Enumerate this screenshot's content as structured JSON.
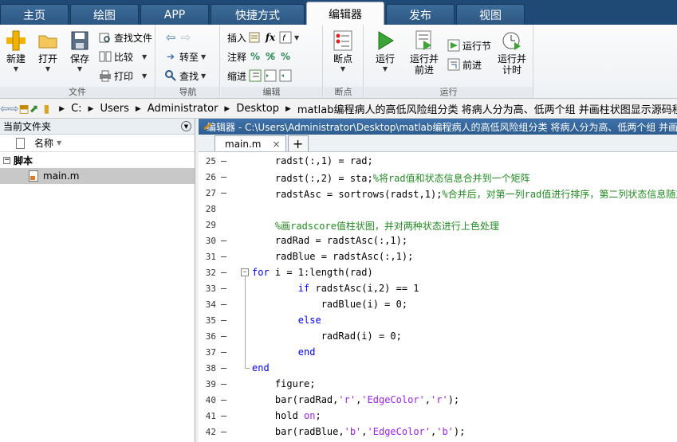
{
  "tabs": [
    "主页",
    "绘图",
    "APP",
    "快捷方式",
    "编辑器",
    "发布",
    "视图"
  ],
  "ribbon": {
    "file": {
      "new": "新建",
      "open": "打开",
      "save": "保存",
      "find_files": "查找文件",
      "compare": "比较",
      "print": "打印",
      "label": "文件"
    },
    "nav": {
      "goto": "转至",
      "find": "查找",
      "label": "导航"
    },
    "edit": {
      "insert": "插入",
      "comment": "注释",
      "indent": "缩进",
      "fx": "fx",
      "label": "编辑"
    },
    "breakpoints": {
      "bp": "断点",
      "label": "断点"
    },
    "run": {
      "run": "运行",
      "run_advance": "运行并\n前进",
      "run_section": "运行节",
      "advance": "前进",
      "run_time": "运行并\n计时",
      "label": "运行"
    }
  },
  "address": {
    "crumbs": [
      "C:",
      "Users",
      "Administrator",
      "Desktop",
      "matlab编程病人的高低风险组分类 将病人分为高、低两个组 并画柱状图显示源码程序"
    ]
  },
  "left_panel": {
    "title": "当前文件夹",
    "col_name": "名称",
    "group": "脚本",
    "file": "main.m"
  },
  "editor": {
    "title": "编辑器 - C:\\Users\\Administrator\\Desktop\\matlab编程病人的高低风险组分类 将病人分为高、低两个组 并画柱状图显示源码程序\\main.m",
    "tab": "main.m",
    "tab_close": "×",
    "add": "+"
  },
  "code_lines": [
    {
      "n": "25",
      "dash": "–",
      "parts": [
        [
          "    radst(:,1) = rad;",
          ""
        ]
      ]
    },
    {
      "n": "26",
      "dash": "–",
      "parts": [
        [
          "    radst(:,2) = sta;",
          ""
        ],
        [
          "%将rad值和状态信息合并到一个矩阵",
          "cm"
        ]
      ]
    },
    {
      "n": "27",
      "dash": "–",
      "parts": [
        [
          "    radstAsc = sortrows(radst,1);",
          ""
        ],
        [
          "%合并后，对第一列rad值进行排序，第二列状态信息随之变化",
          "cm"
        ]
      ]
    },
    {
      "n": "28",
      "dash": "",
      "parts": [
        [
          "",
          ""
        ]
      ]
    },
    {
      "n": "29",
      "dash": "",
      "parts": [
        [
          "    ",
          ""
        ],
        [
          "%画radscore值柱状图，并对两种状态进行上色处理",
          "cm"
        ]
      ]
    },
    {
      "n": "30",
      "dash": "–",
      "parts": [
        [
          "    radRad = radstAsc(:,1);",
          ""
        ]
      ]
    },
    {
      "n": "31",
      "dash": "–",
      "parts": [
        [
          "    radBlue = radstAsc(:,1);",
          ""
        ]
      ]
    },
    {
      "n": "32",
      "dash": "–",
      "fold": "−",
      "parts": [
        [
          "for",
          "kw"
        ],
        [
          " i = 1:length(rad)",
          ""
        ]
      ]
    },
    {
      "n": "33",
      "dash": "–",
      "parts": [
        [
          "        ",
          ""
        ],
        [
          "if",
          "kw"
        ],
        [
          " radstAsc(i,2) == 1",
          ""
        ]
      ]
    },
    {
      "n": "34",
      "dash": "–",
      "parts": [
        [
          "            radBlue(i) = 0;",
          ""
        ]
      ]
    },
    {
      "n": "35",
      "dash": "–",
      "parts": [
        [
          "        ",
          ""
        ],
        [
          "else",
          "kw"
        ]
      ]
    },
    {
      "n": "36",
      "dash": "–",
      "parts": [
        [
          "            radRad(i) = 0;",
          ""
        ]
      ]
    },
    {
      "n": "37",
      "dash": "–",
      "parts": [
        [
          "        ",
          ""
        ],
        [
          "end",
          "kw"
        ]
      ]
    },
    {
      "n": "38",
      "dash": "–",
      "parts": [
        [
          "end",
          "kw"
        ]
      ]
    },
    {
      "n": "39",
      "dash": "–",
      "parts": [
        [
          "    figure;",
          ""
        ]
      ]
    },
    {
      "n": "40",
      "dash": "–",
      "parts": [
        [
          "    bar(radRad,",
          ""
        ],
        [
          "'r'",
          "st"
        ],
        [
          ",",
          ""
        ],
        [
          "'EdgeColor'",
          "st"
        ],
        [
          ",",
          ""
        ],
        [
          "'r'",
          "st"
        ],
        [
          ");",
          ""
        ]
      ]
    },
    {
      "n": "41",
      "dash": "–",
      "parts": [
        [
          "    hold ",
          ""
        ],
        [
          "on",
          "st"
        ],
        [
          ";",
          ""
        ]
      ]
    },
    {
      "n": "42",
      "dash": "–",
      "parts": [
        [
          "    bar(radBlue,",
          ""
        ],
        [
          "'b'",
          "st"
        ],
        [
          ",",
          ""
        ],
        [
          "'EdgeColor'",
          "st"
        ],
        [
          ",",
          ""
        ],
        [
          "'b'",
          "st"
        ],
        [
          ");",
          ""
        ]
      ]
    }
  ]
}
